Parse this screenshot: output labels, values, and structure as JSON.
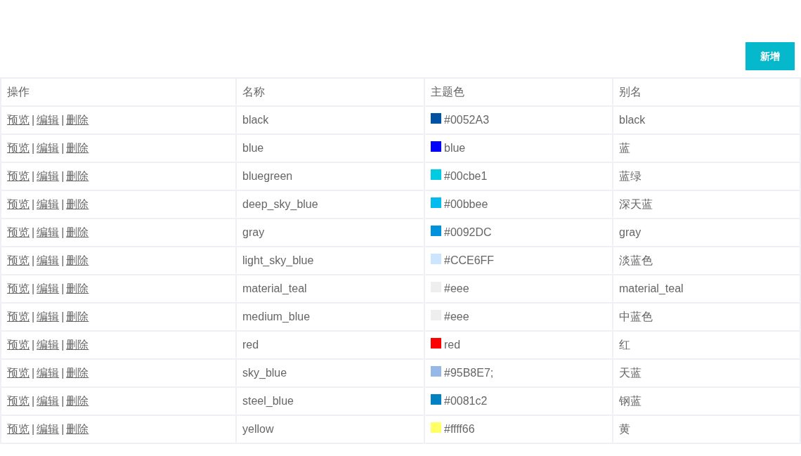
{
  "add_button": "新增",
  "table": {
    "columns": [
      "操作",
      "名称",
      "主题色",
      "别名"
    ],
    "rows": [
      {
        "actions": [
          "预览",
          "编辑",
          "删除"
        ],
        "separator": "|",
        "name": "black",
        "theme": "#0052A3",
        "color": "#0052a3",
        "alias": "black"
      },
      {
        "actions": [
          "预览",
          "编辑",
          "删除"
        ],
        "separator": "|",
        "name": "blue",
        "theme": "blue",
        "color": "#0000ff",
        "alias": "蓝"
      },
      {
        "actions": [
          "预览",
          "编辑",
          "删除"
        ],
        "separator": "|",
        "name": "bluegreen",
        "theme": "#00cbe1",
        "color": "#00cbe1",
        "alias": "蓝绿"
      },
      {
        "actions": [
          "预览",
          "编辑",
          "删除"
        ],
        "separator": "|",
        "name": "deep_sky_blue",
        "theme": "#00bbee",
        "color": "#00bbee",
        "alias": "深天蓝"
      },
      {
        "actions": [
          "预览",
          "编辑",
          "删除"
        ],
        "separator": "|",
        "name": "gray",
        "theme": "#0092DC",
        "color": "#0092dc",
        "alias": "gray"
      },
      {
        "actions": [
          "预览",
          "编辑",
          "删除"
        ],
        "separator": "|",
        "name": "light_sky_blue",
        "theme": "#CCE6FF",
        "color": "#cce6ff",
        "alias": "淡蓝色"
      },
      {
        "actions": [
          "预览",
          "编辑",
          "删除"
        ],
        "separator": "|",
        "name": "material_teal",
        "theme": "#eee",
        "color": "#eeeeee",
        "alias": "material_teal"
      },
      {
        "actions": [
          "预览",
          "编辑",
          "删除"
        ],
        "separator": "|",
        "name": "medium_blue",
        "theme": "#eee",
        "color": "#eeeeee",
        "alias": "中蓝色"
      },
      {
        "actions": [
          "预览",
          "编辑",
          "删除"
        ],
        "separator": "|",
        "name": "red",
        "theme": "red",
        "color": "#ff0000",
        "alias": "红"
      },
      {
        "actions": [
          "预览",
          "编辑",
          "删除"
        ],
        "separator": "|",
        "name": "sky_blue",
        "theme": "#95B8E7;",
        "color": "#95b8e7",
        "alias": "天蓝"
      },
      {
        "actions": [
          "预览",
          "编辑",
          "删除"
        ],
        "separator": "|",
        "name": "steel_blue",
        "theme": "#0081c2",
        "color": "#0081c2",
        "alias": "钢蓝"
      },
      {
        "actions": [
          "预览",
          "编辑",
          "删除"
        ],
        "separator": "|",
        "name": "yellow",
        "theme": "#ffff66",
        "color": "#ffff66",
        "alias": "黄"
      }
    ]
  }
}
